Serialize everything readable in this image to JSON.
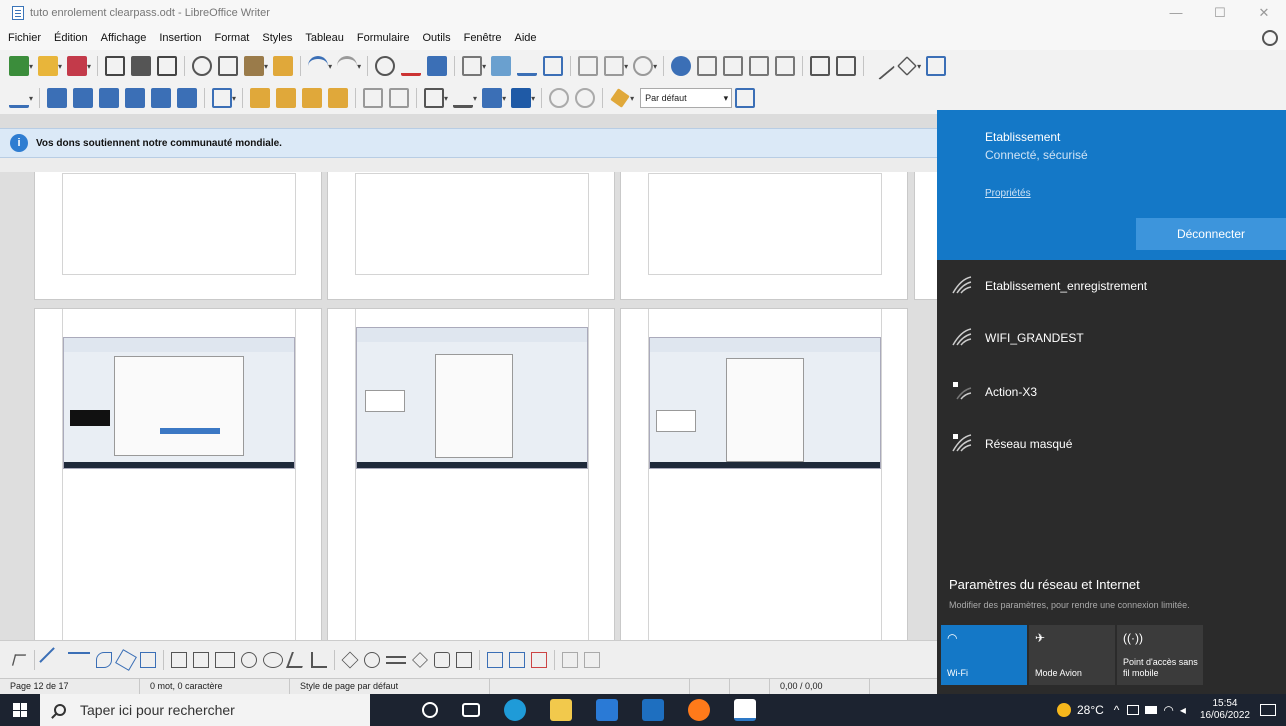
{
  "window": {
    "title": "tuto enrolement clearpass.odt - LibreOffice Writer",
    "minimize": "—",
    "maximize": "☐",
    "close": "✕"
  },
  "menu": {
    "items": [
      "Fichier",
      "Édition",
      "Affichage",
      "Insertion",
      "Format",
      "Styles",
      "Tableau",
      "Formulaire",
      "Outils",
      "Fenêtre",
      "Aide"
    ]
  },
  "toolbar": {
    "paragraph_style": "Par défaut"
  },
  "infobar": {
    "icon": "info-icon",
    "text": "Vos dons soutiennent notre communauté mondiale."
  },
  "statusbar": {
    "page": "Page 12 de 17",
    "words": "0 mot, 0 caractère",
    "page_style": "Style de page par défaut",
    "position": "0,00 / 0,00"
  },
  "taskbar": {
    "search_placeholder": "Taper ici pour rechercher",
    "temperature": "28°C",
    "time": "15:54",
    "date": "16/06/2022"
  },
  "network": {
    "active": {
      "name": "Etablissement",
      "status": "Connecté, sécurisé",
      "properties_link": "Propriétés",
      "disconnect_label": "Déconnecter"
    },
    "others": [
      {
        "name": "Etablissement_enregistrement",
        "secured": false
      },
      {
        "name": "WIFI_GRANDEST",
        "secured": false
      },
      {
        "name": "Action-X3",
        "secured": true
      },
      {
        "name": "Réseau masqué",
        "secured": true
      }
    ],
    "settings_title": "Paramètres du réseau et Internet",
    "settings_subtitle": "Modifier des paramètres, pour rendre une connexion limitée.",
    "quick_actions": [
      {
        "label": "Wi-Fi",
        "icon": "wifi-icon",
        "active": true
      },
      {
        "label": "Mode Avion",
        "icon": "airplane-icon",
        "active": false
      },
      {
        "label": "Point d'accès sans fil mobile",
        "icon": "hotspot-icon",
        "active": false
      }
    ]
  },
  "colors": {
    "accent": "#1478c7",
    "flyout_bg": "#2b2b2b",
    "taskbar_bg": "#1c2330",
    "infobar_bg": "#dbe9f7"
  }
}
